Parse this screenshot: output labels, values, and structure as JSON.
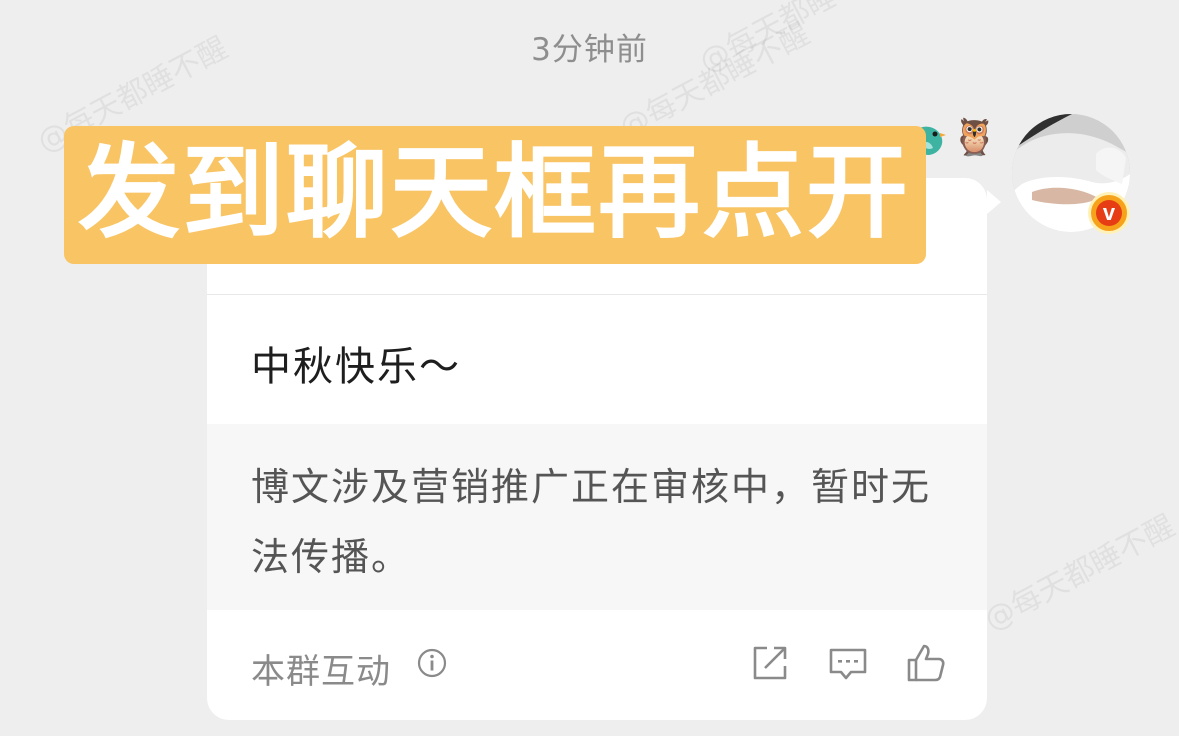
{
  "timestamp": "3分钟前",
  "watermark": "@每天都睡不醒",
  "message_card": {
    "post_text": "中秋快乐～",
    "review_notice": "博文涉及营销推广正在审核中，暂时无法传播。",
    "footer_label": "本群互动"
  },
  "banner": {
    "text": "发到聊天框再点开",
    "color": "#f9c463"
  },
  "colors": {
    "background": "#eeeeee",
    "card": "#ffffff",
    "notice_bg": "#f7f7f7",
    "verify_badge": "#f6a21b"
  },
  "icons": [
    "owl-emoji-icon",
    "bird-icon",
    "verified-v-badge-icon",
    "info-icon",
    "share-icon",
    "comment-icon",
    "like-icon"
  ]
}
